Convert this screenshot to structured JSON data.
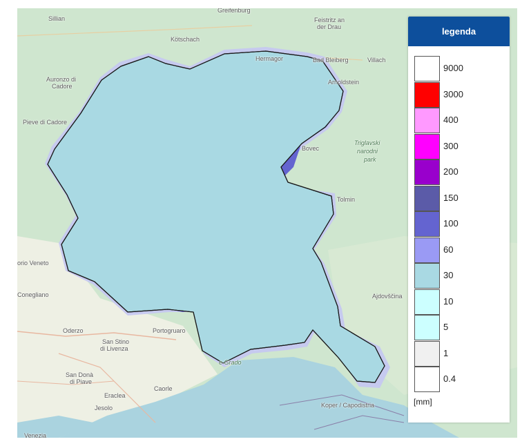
{
  "legend": {
    "title": "legenda",
    "unit": "[mm]",
    "items": [
      {
        "label": "9000",
        "color": "#ffffff"
      },
      {
        "label": "3000",
        "color": "#ff0000"
      },
      {
        "label": "400",
        "color": "#ff99ff"
      },
      {
        "label": "300",
        "color": "#ff00ff"
      },
      {
        "label": "200",
        "color": "#9900cc"
      },
      {
        "label": "150",
        "color": "#5b5ba8"
      },
      {
        "label": "100",
        "color": "#6464d0"
      },
      {
        "label": "60",
        "color": "#9a9af4"
      },
      {
        "label": "30",
        "color": "#a9d9e3"
      },
      {
        "label": "10",
        "color": "#ccffff"
      },
      {
        "label": "5",
        "color": "#ccffff"
      },
      {
        "label": "1",
        "color": "#f0f0f0"
      },
      {
        "label": "0.4",
        "color": "#ffffff"
      }
    ]
  },
  "map_labels": {
    "sillian": "Sillian",
    "greifenburg": "Greifenburg",
    "feistritz": "Feistritz an",
    "feistritz2": "der Drau",
    "kotschach": "Kötschach",
    "hermagor": "Hermagor",
    "bad_bleiberg": "Bad Bleiberg",
    "villach": "Villach",
    "auronzo": "Auronzo di",
    "auronzo2": "Cadore",
    "arnoldstein": "Arnoldstein",
    "pieve": "Pieve di Cadore",
    "bovec": "Bovec",
    "triglav": "Triglavski",
    "triglav2": "narodni",
    "triglav3": "park",
    "tolmin": "Tolmin",
    "vittorio": "orio Veneto",
    "conegliano": "Conegliano",
    "ajdovscina": "Ajdovščina",
    "oderzo": "Oderzo",
    "portogruaro": "Portogruaro",
    "san_stino": "San Stino",
    "san_stino2": "di Livenza",
    "san_dona": "San Donà",
    "san_dona2": "di Piave",
    "eraclea": "Eraclea",
    "caorle": "Caorle",
    "jesolo": "Jesolo",
    "koper": "Koper / Capodistria",
    "venezia": "Venezia",
    "grado": "e Grado"
  }
}
